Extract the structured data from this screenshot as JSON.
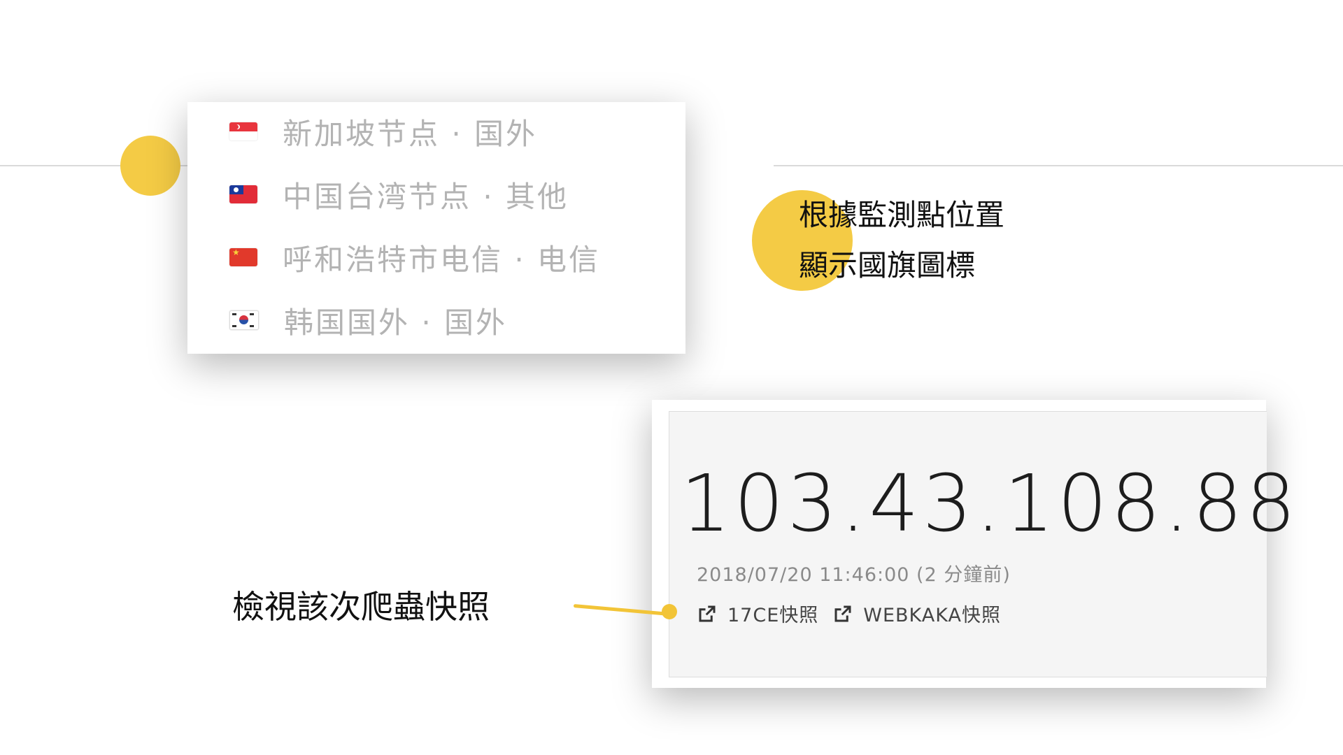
{
  "nodes": [
    {
      "flag": "singapore-flag-icon",
      "label": "新加坡节点 · 国外"
    },
    {
      "flag": "taiwan-flag-icon",
      "label": "中国台湾节点 · 其他"
    },
    {
      "flag": "china-flag-icon",
      "label": "呼和浩特市电信 · 电信"
    },
    {
      "flag": "korea-flag-icon",
      "label": "韩国国外 · 国外"
    }
  ],
  "annotations": {
    "flag_line1": "根據監測點位置",
    "flag_line2": "顯示國旗圖標",
    "snapshot": "檢視該次爬蟲快照"
  },
  "snapshot": {
    "ip": "103.43.108.88",
    "timestamp": "2018/07/20 11:46:00 (2 分鐘前)",
    "links": [
      {
        "icon": "external-link-icon",
        "label": "17CE快照"
      },
      {
        "icon": "external-link-icon",
        "label": "WEBKAKA快照"
      }
    ]
  },
  "colors": {
    "accent_yellow": "#f4cb45",
    "node_text": "#b3b3b3",
    "ip_text": "#1d1d1d",
    "timestamp_text": "#8a8a8a"
  }
}
